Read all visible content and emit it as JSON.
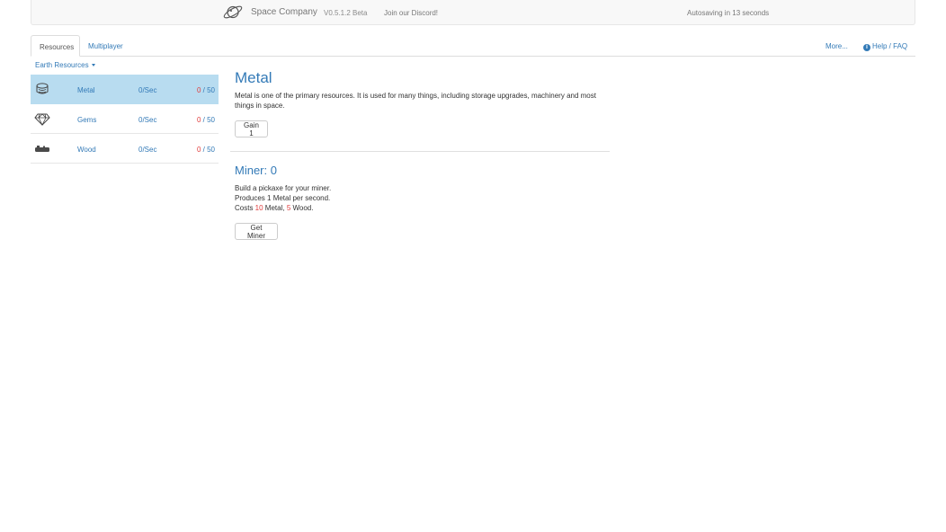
{
  "navbar": {
    "brand_icon": "planet-icon",
    "title": "Space Company",
    "version": "V0.5.1.2 Beta",
    "discord_link": "Join our Discord!",
    "autosave_text": "Autosaving in 13 seconds"
  },
  "tabs": [
    {
      "label": "Resources",
      "active": true
    },
    {
      "label": "Multiplayer",
      "active": false
    }
  ],
  "header_links": {
    "more": "More...",
    "help_icon": "info-circle-icon",
    "help": "Help / FAQ"
  },
  "sidebar": {
    "category": "Earth Resources",
    "resources": [
      {
        "icon": "metal-ore-icon",
        "name": "Metal",
        "rate": "0/Sec",
        "current": "0",
        "separator": " / ",
        "max": "50",
        "active": true
      },
      {
        "icon": "gem-icon",
        "name": "Gems",
        "rate": "0/Sec",
        "current": "0",
        "separator": " / ",
        "max": "50",
        "active": false
      },
      {
        "icon": "wood-log-icon",
        "name": "Wood",
        "rate": "0/Sec",
        "current": "0",
        "separator": " / ",
        "max": "50",
        "active": false
      }
    ]
  },
  "main": {
    "title": "Metal",
    "description": "Metal is one of the primary resources. It is used for many things, including storage upgrades, machinery and most things in space.",
    "gain_button": "Gain 1",
    "miner": {
      "title": "Miner: 0",
      "line1": "Build a pickaxe for your miner.",
      "line2": "Produces 1 Metal per second.",
      "cost_prefix": "Costs ",
      "cost_metal_amount": "10",
      "cost_metal_label": " Metal, ",
      "cost_wood_amount": "5",
      "cost_wood_label": " Wood.",
      "button": "Get Miner"
    }
  },
  "colors": {
    "accent": "#337ab7",
    "active_row": "#b8dcf0",
    "warning_red": "#e03b3b"
  }
}
